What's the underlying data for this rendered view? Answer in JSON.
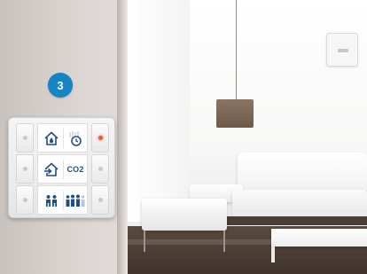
{
  "badge": {
    "number": "3",
    "color": "#1584c6"
  },
  "panel": {
    "rows": [
      {
        "left_icon": "home-water-drop-icon",
        "right_icon": "temperature-clock-icon",
        "led": true
      },
      {
        "left_icon": "home-enter-arrow-icon",
        "right_label": "CO2",
        "led": false
      },
      {
        "left_icon": "two-people-icon",
        "right_icon": "group-people-icon",
        "led": false
      }
    ],
    "icon_color": "#1e4f8a",
    "led_color": "#f05a28"
  }
}
